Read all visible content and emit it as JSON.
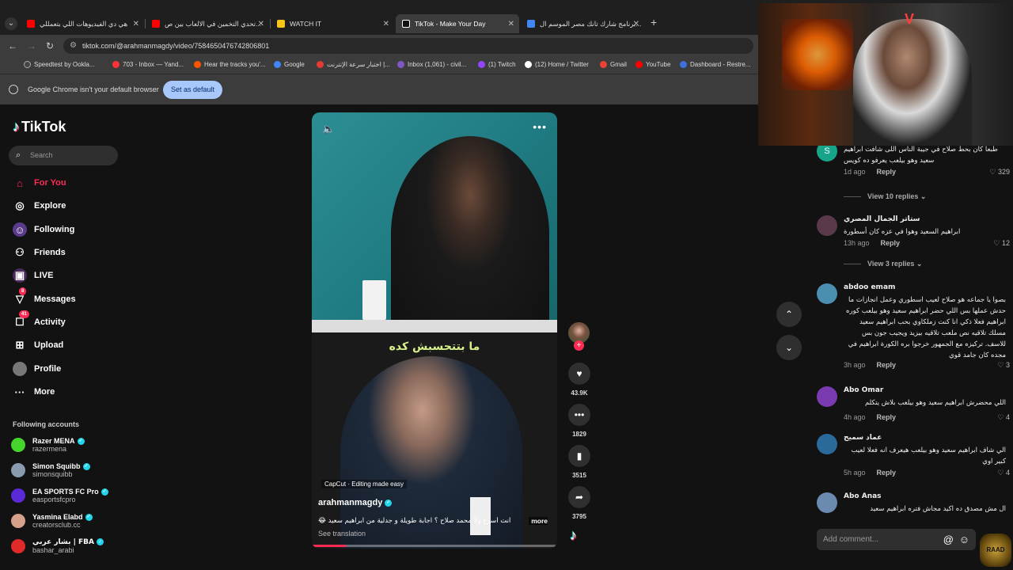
{
  "browser": {
    "tabs": [
      {
        "title": "هي دي الفيديوهات اللي بتعمللي",
        "color": "#ff0000"
      },
      {
        "title": "تحدي التخمين في الالعاب بين ص...",
        "color": "#ff0000"
      },
      {
        "title": "WATCH IT",
        "color": "#f5c518"
      },
      {
        "title": "TikTok - Make Your Day",
        "color": "#ffffff"
      },
      {
        "title": "برنامج شارك تانك مصر الموسم ال...",
        "color": "#4285f4"
      }
    ],
    "url": "tiktok.com/@arahmanmagdy/video/7584650476742806801",
    "bookmarks": [
      {
        "label": "Speedtest by Ookla...",
        "color": "#444"
      },
      {
        "label": "703 - Inbox — Yand...",
        "color": "#ff3333"
      },
      {
        "label": "Hear the tracks you'...",
        "color": "#ff5500"
      },
      {
        "label": "Google",
        "color": "#4285f4"
      },
      {
        "label": "اختبار سرعة الإنترنت |...",
        "color": "#e53935"
      },
      {
        "label": "Inbox (1,061) - civil...",
        "color": "#7e57c2"
      },
      {
        "label": "(1) Twitch",
        "color": "#9146ff"
      },
      {
        "label": "(12) Home / Twitter",
        "color": "#ffffff"
      },
      {
        "label": "Gmail",
        "color": "#ea4335"
      },
      {
        "label": "YouTube",
        "color": "#ff0000"
      },
      {
        "label": "Dashboard - Restre...",
        "color": "#3f6fd8"
      }
    ],
    "infobar_message": "Google Chrome isn't your default browser",
    "set_default_label": "Set as default"
  },
  "tiktok": {
    "logo": "TikTok",
    "search_placeholder": "Search",
    "nav": [
      {
        "label": "For You",
        "icon": "home-icon"
      },
      {
        "label": "Explore",
        "icon": "compass-icon"
      },
      {
        "label": "Following",
        "icon": "following-icon"
      },
      {
        "label": "Friends",
        "icon": "friends-icon"
      },
      {
        "label": "LIVE",
        "icon": "live-icon"
      },
      {
        "label": "Messages",
        "icon": "messages-icon",
        "badge": "8"
      },
      {
        "label": "Activity",
        "icon": "activity-icon",
        "badge": "41"
      },
      {
        "label": "Upload",
        "icon": "upload-icon"
      },
      {
        "label": "Profile",
        "icon": "profile-icon"
      },
      {
        "label": "More",
        "icon": "more-icon"
      }
    ],
    "following_title": "Following accounts",
    "following": [
      {
        "name": "Razer MENA",
        "handle": "razermena",
        "color": "#44d62c"
      },
      {
        "name": "Simon Squibb",
        "handle": "simonsquibb",
        "color": "#8a9bb0"
      },
      {
        "name": "EA SPORTS FC Pro",
        "handle": "easportsfcpro",
        "color": "#5a2ad6"
      },
      {
        "name": "Yasmina Elabd",
        "handle": "creatorsclub.cc",
        "color": "#d6a08a"
      },
      {
        "name": "بشار عربي | FBA",
        "handle": "bashar_arabi",
        "color": "#e02a2a"
      }
    ]
  },
  "video": {
    "subtitle": "ما بتتحسبش كده",
    "capcut": "CapCut · Editing made easy",
    "author": "arahmanmagdy",
    "caption": "😂 انت أسرع ولا محمد صلاح ؟ اجابة طويلة و جدلية من ابراهيم سعيد",
    "more": "more",
    "see_translation": "See translation",
    "progress": 0.14,
    "likes": "43.9K",
    "comments": "1829",
    "saves": "3515",
    "shares": "3795"
  },
  "comments": [
    {
      "name": "",
      "avatar_letter": "S",
      "color": "#17a589",
      "text": "طبعا كان بحط صلاح في جيبة الناس اللى شافت ابراهيم سعيد وهو بيلعب يعرفو ده كويس",
      "time": "1d ago",
      "reply": "Reply",
      "likes": "329",
      "view_replies": "View 10 replies"
    },
    {
      "name": "ستاتر الجمال المصري",
      "color": "#5a3a4a",
      "text": "ابراهيم السعيد وهوا في عزه كان أسطورة",
      "time": "13h ago",
      "reply": "Reply",
      "likes": "12",
      "view_replies": "View 3 replies"
    },
    {
      "name": "abdoo emam",
      "color": "#4a8fb0",
      "text": "بصوا يا جماعه هو صلاح لعيب اسطوري وعمل انجازات ما حدش عملها بس اللي حضر ابراهيم سعيد وهو بيلعب كوره ابراهيم فعلا ذكي انا كنت زملكاوي بحب ابراهيم سعيد مسلك تلاقيه نص ملعب تلاقيه بيزيد ويجيب جون بس للاسف. تركيزه مع الجمهور خرجوا بره الكورة ابراهيم في مجده كان جامد قوي",
      "time": "3h ago",
      "reply": "Reply",
      "likes": "3"
    },
    {
      "name": "Abo Omar",
      "color": "#7a3ab0",
      "text": "اللي محضرش ابراهيم سعيد وهو بيلعب بلاش يتكلم",
      "time": "4h ago",
      "reply": "Reply",
      "likes": "4"
    },
    {
      "name": "عماد سميح",
      "color": "#2a6a9a",
      "text": "الي شاف ابراهيم سعيد وهو بيلعب هيعرف انه فعلا لعيب كبير اوي",
      "time": "5h ago",
      "reply": "Reply",
      "likes": "4"
    },
    {
      "name": "Abo Anas",
      "color": "#6a8ab0",
      "text": "ال مش مصدق ده اكيد مجاش فتره ابراهيم سعيد",
      "time": "",
      "reply": "",
      "likes": ""
    }
  ],
  "add_comment_placeholder": "Add comment...",
  "overlay": {
    "raad_label": "RAAD"
  }
}
